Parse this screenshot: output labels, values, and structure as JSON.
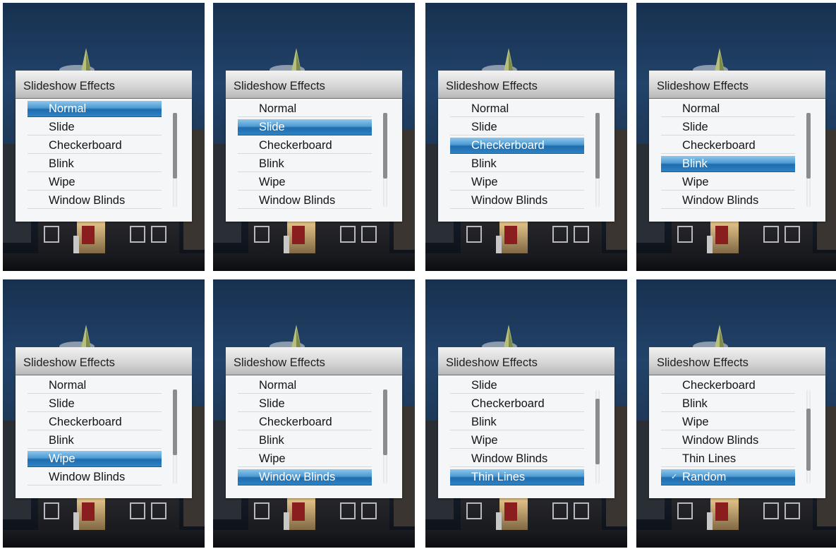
{
  "dialog_title": "Slideshow Effects",
  "panels": [
    {
      "items": [
        "Normal",
        "Slide",
        "Checkerboard",
        "Blink",
        "Wipe",
        "Window Blinds"
      ],
      "selected": 0,
      "scroll": {
        "top": 0,
        "thumb": 0.85
      }
    },
    {
      "items": [
        "Normal",
        "Slide",
        "Checkerboard",
        "Blink",
        "Wipe",
        "Window Blinds"
      ],
      "selected": 1,
      "scroll": {
        "top": 0,
        "thumb": 0.85
      }
    },
    {
      "items": [
        "Normal",
        "Slide",
        "Checkerboard",
        "Blink",
        "Wipe",
        "Window Blinds"
      ],
      "selected": 2,
      "scroll": {
        "top": 0,
        "thumb": 0.85
      }
    },
    {
      "items": [
        "Normal",
        "Slide",
        "Checkerboard",
        "Blink",
        "Wipe",
        "Window Blinds"
      ],
      "selected": 3,
      "scroll": {
        "top": 0,
        "thumb": 0.85
      }
    },
    {
      "items": [
        "Normal",
        "Slide",
        "Checkerboard",
        "Blink",
        "Wipe",
        "Window Blinds"
      ],
      "selected": 4,
      "scroll": {
        "top": 0,
        "thumb": 0.85
      }
    },
    {
      "items": [
        "Normal",
        "Slide",
        "Checkerboard",
        "Blink",
        "Wipe",
        "Window Blinds"
      ],
      "selected": 5,
      "scroll": {
        "top": 0,
        "thumb": 0.85
      }
    },
    {
      "items": [
        "Slide",
        "Checkerboard",
        "Blink",
        "Wipe",
        "Window Blinds",
        "Thin Lines"
      ],
      "selected": 5,
      "scroll": {
        "top": 0.1,
        "thumb": 0.85
      }
    },
    {
      "items": [
        "Checkerboard",
        "Blink",
        "Wipe",
        "Window Blinds",
        "Thin Lines",
        "Random"
      ],
      "selected": 5,
      "checked": 5,
      "scroll": {
        "top": 0.2,
        "thumb": 0.8
      }
    }
  ],
  "checkmark": "✓",
  "colors": {
    "highlight": "#2e83c4",
    "dialog_bg": "#f4f6f7",
    "header_bg": "#d6d6d6",
    "scroll_thumb": "#8c8c8c"
  }
}
